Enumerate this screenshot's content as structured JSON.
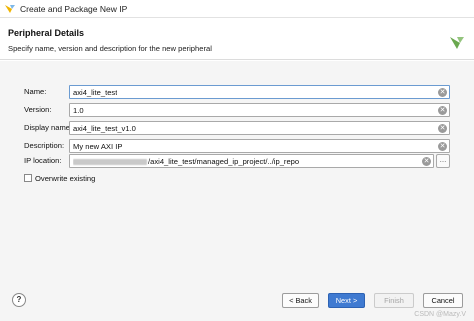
{
  "window": {
    "title": "Create and Package New IP"
  },
  "header": {
    "title": "Peripheral Details",
    "subtitle": "Specify name, version and description for the new peripheral"
  },
  "form": {
    "name": {
      "label": "Name:",
      "value": "axi4_lite_test"
    },
    "version": {
      "label": "Version:",
      "value": "1.0"
    },
    "display_name": {
      "label": "Display name:",
      "value": "axi4_lite_test_v1.0"
    },
    "description": {
      "label": "Description:",
      "value": "My new AXI IP"
    },
    "ip_location": {
      "label": "IP location:",
      "value": "/axi4_lite_test/managed_ip_project/../ip_repo",
      "browse_label": "…"
    },
    "overwrite": {
      "label": "Overwrite existing",
      "checked": false
    }
  },
  "footer": {
    "help_label": "?",
    "back_label": "< Back",
    "next_label": "Next >",
    "finish_label": "Finish",
    "cancel_label": "Cancel"
  },
  "watermark": "CSDN @Mazy.V",
  "colors": {
    "primary_button": "#3f7ad1",
    "content_bg": "#f5f5f5",
    "disabled_text": "#a5a5a5"
  },
  "icons": {
    "app_icon": "vivado-logo-icon",
    "header_logo": "vivado-logo-icon",
    "clear": "clear-circle-icon",
    "help": "help-icon"
  }
}
